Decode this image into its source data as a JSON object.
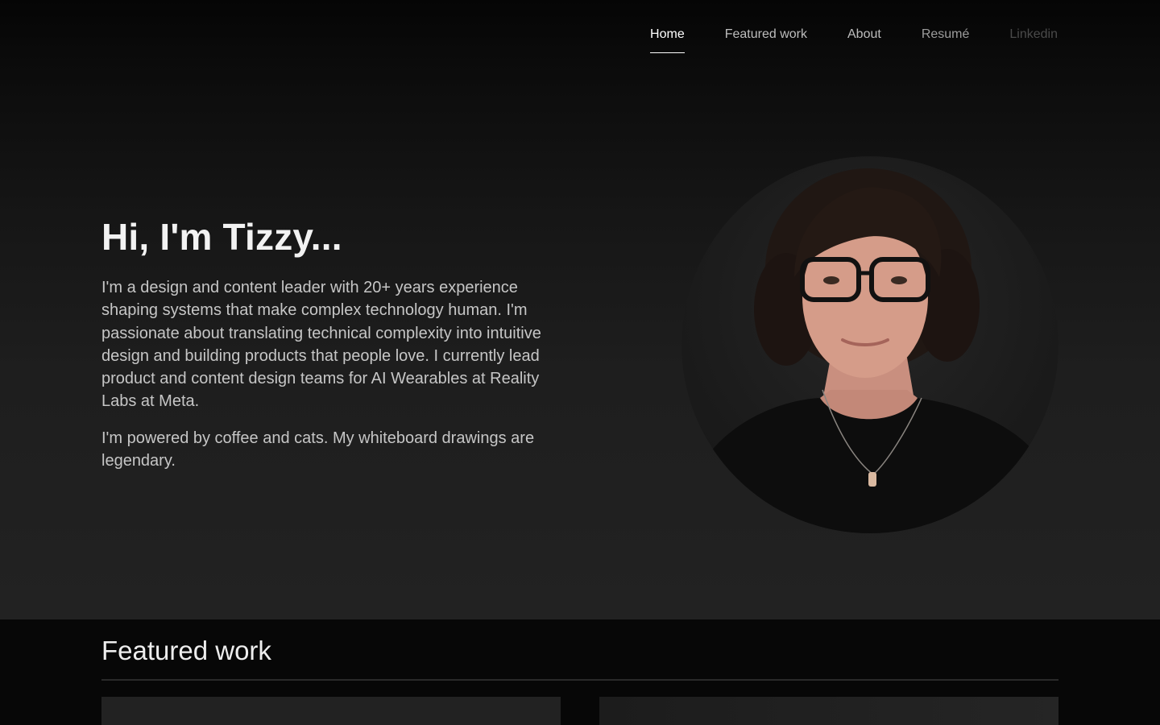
{
  "nav": {
    "items": [
      {
        "label": "Home",
        "active": true
      },
      {
        "label": "Featured work",
        "active": false
      },
      {
        "label": "About",
        "active": false
      },
      {
        "label": "Resumé",
        "active": false
      },
      {
        "label": "Linkedin",
        "active": false
      }
    ]
  },
  "hero": {
    "title": "Hi, I'm Tizzy...",
    "paragraph1": "I'm a design and content leader with 20+ years experience shaping systems that make complex technology human. I'm passionate about translating technical complexity into intuitive design and building products that people love. I currently lead product and content design teams for AI Wearables at Reality Labs at Meta.",
    "paragraph2": "I'm powered by coffee and cats. My whiteboard drawings are legendary."
  },
  "featured": {
    "title": "Featured work"
  },
  "colors": {
    "background": "#070707",
    "hero_bottom": "#222222",
    "text_primary": "#f2f2f2",
    "text_secondary": "#c6c6c6"
  }
}
